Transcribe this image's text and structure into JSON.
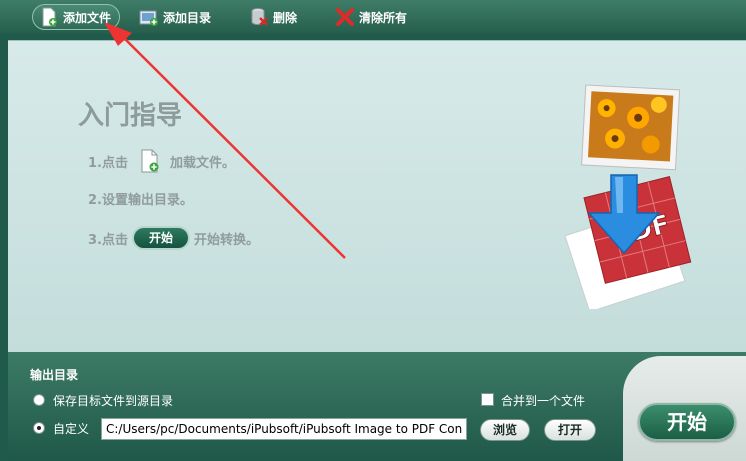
{
  "toolbar": {
    "add_file": "添加文件",
    "add_folder": "添加目录",
    "delete": "删除",
    "clear_all": "清除所有"
  },
  "guide": {
    "title": "入门指导",
    "step1_prefix": "1.点击",
    "step1_suffix": "加载文件。",
    "step2": "2.设置输出目录。",
    "step3_prefix": "3.点击",
    "step3_button": "开始",
    "step3_suffix": "开始转换。"
  },
  "hero": {
    "badge": "PDF"
  },
  "output": {
    "title": "输出目录",
    "save_to_source": "保存目标文件到源目录",
    "custom": "自定义",
    "path_value": "C:/Users/pc/Documents/iPubsoft/iPubsoft Image to PDF Converter",
    "merge_label": "合并到一个文件",
    "browse": "浏览",
    "open": "打开",
    "start": "开始"
  },
  "colors": {
    "theme_green": "#255e4c",
    "panel_bg": "#d7eae9",
    "annotation_arrow": "#ee3333"
  }
}
